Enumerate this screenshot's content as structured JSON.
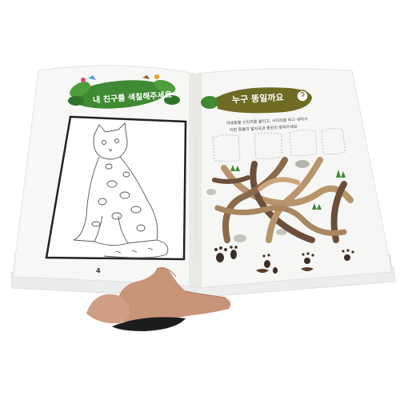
{
  "left_page": {
    "banner_text": "내 친구를 색칠해주세요",
    "page_number": "4",
    "illustration": "leopard-cat-outline"
  },
  "right_page": {
    "title": "누구 똥일까요",
    "instruction_line_1": "야생동물 스티커를 붙이고, 사다리를 타고 내려가",
    "instruction_line_2": "어떤 동물의 발자국과 똥인지 맞혀주세요"
  },
  "colors": {
    "leaf_green": "#3f8a32",
    "banner_olive": "#6f6a24",
    "branch_brown": "#6b4f3a",
    "branch_tan": "#b8946a",
    "page_white": "#f7f7f5"
  }
}
